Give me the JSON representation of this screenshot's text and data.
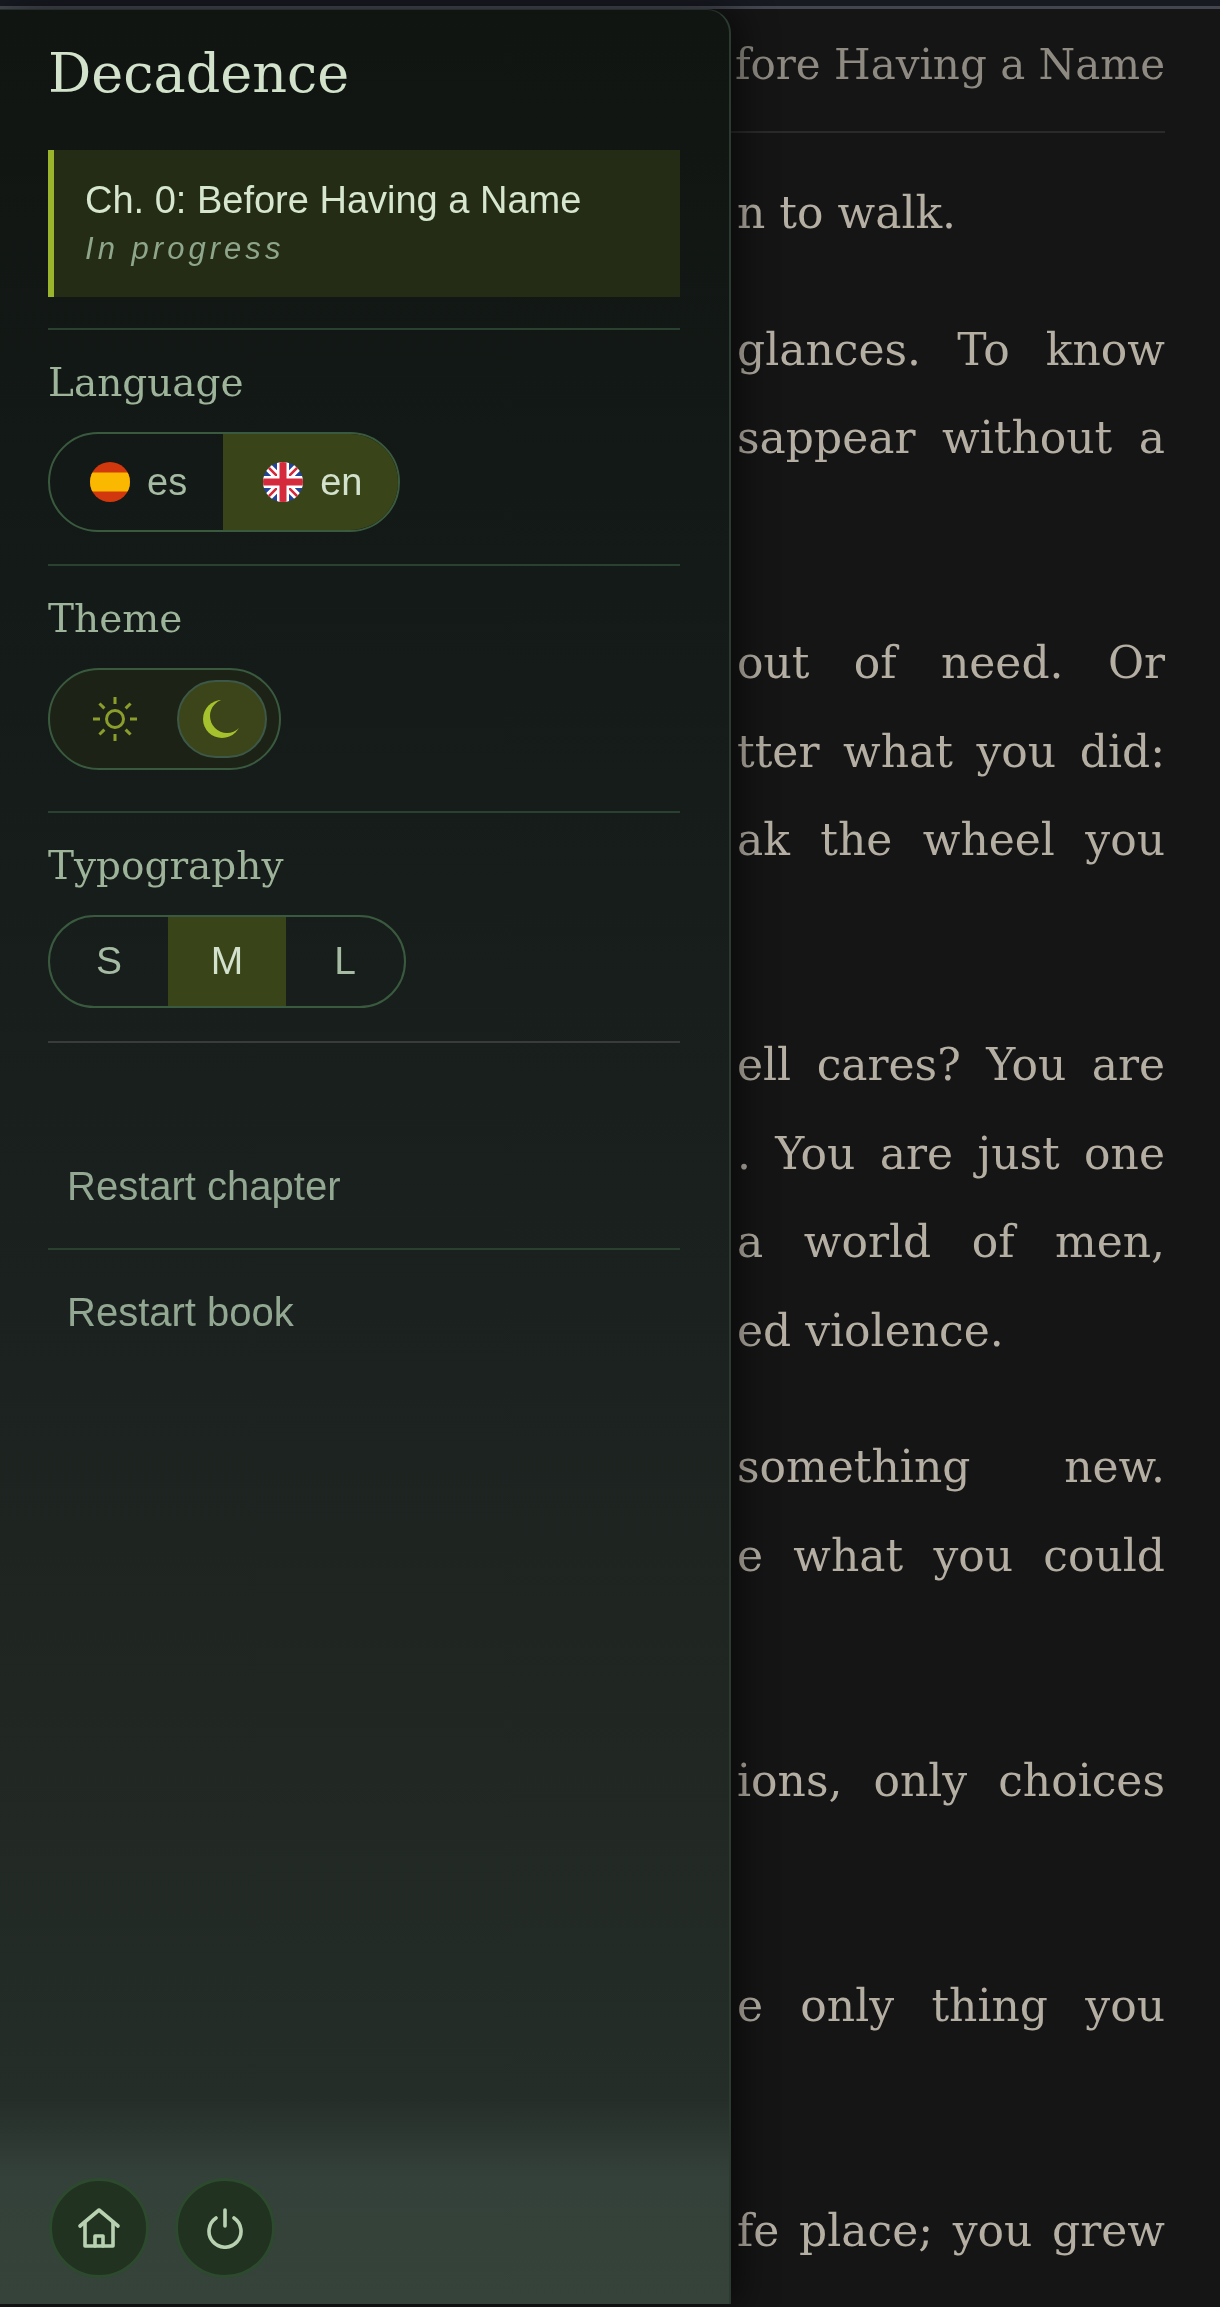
{
  "drawer": {
    "title": "Decadence",
    "current_chapter": {
      "title": "Ch. 0: Before Having a Name",
      "status": "In progress"
    },
    "sections": [
      {
        "kind": "flags",
        "label": "Language",
        "options": [
          {
            "kind": "spanish",
            "label": "es",
            "selected": false
          },
          {
            "kind": "english",
            "label": "en",
            "selected": true
          }
        ]
      },
      {
        "kind": "toggle",
        "label": "Theme",
        "options": [
          {
            "kind": "light",
            "selected": false
          },
          {
            "kind": "dark",
            "selected": true
          }
        ]
      },
      {
        "kind": "sizes",
        "label": "Typography",
        "options": [
          {
            "label": "S",
            "selected": false
          },
          {
            "label": "M",
            "selected": true
          },
          {
            "label": "L",
            "selected": false
          }
        ]
      }
    ],
    "actions": [
      {
        "label": "Restart chapter"
      },
      {
        "label": "Restart book"
      }
    ],
    "footer_buttons": [
      {
        "kind": "home"
      },
      {
        "kind": "power"
      }
    ]
  },
  "reader": {
    "header": "fore Having a Name",
    "paragraphs": [
      {
        "lines": [
          "n to walk."
        ],
        "ends_in_view": true
      },
      {
        "lines": [
          "glances. To know",
          "sappear without a"
        ],
        "ends_in_view": false
      },
      {
        "lines": [
          "out of need. Or",
          "tter what you did:",
          "ak the wheel you"
        ],
        "ends_in_view": false
      },
      {
        "lines": [
          "ell cares? You are",
          ". You are just one",
          "a world of men,",
          "ed violence."
        ],
        "ends_in_view": true
      },
      {
        "lines": [
          "something new.",
          "e what you could"
        ],
        "ends_in_view": false
      },
      {
        "lines": [
          "ions, only choices"
        ],
        "ends_in_view": false
      },
      {
        "lines": [
          "e only thing you"
        ],
        "ends_in_view": false
      },
      {
        "lines": [
          "fe place; you grew"
        ],
        "ends_in_view": false
      }
    ]
  }
}
